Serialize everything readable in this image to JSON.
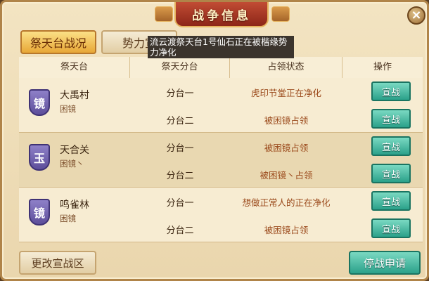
{
  "window": {
    "title": "战争信息",
    "close_label": "×"
  },
  "tabs": [
    {
      "label": "祭天台战况",
      "active": true
    },
    {
      "label": "势力宣",
      "active": false
    }
  ],
  "tooltip": "流云渡祭天台1号仙石正在被楷缘势力净化",
  "table": {
    "headers": [
      "祭天台",
      "祭天分台",
      "占领状态",
      "操作"
    ],
    "groups": [
      {
        "shield_char": "镜",
        "name": "大禹村",
        "occupier": "困镜",
        "rows": [
          {
            "sub": "分台一",
            "status": "虎印节堂正在净化",
            "action": "宣战"
          },
          {
            "sub": "分台二",
            "status": "被困镜占领",
            "action": "宣战"
          }
        ]
      },
      {
        "shield_char": "玉",
        "name": "天合关",
        "occupier": "困镜丶",
        "rows": [
          {
            "sub": "分台一",
            "status": "被困镜占领",
            "action": "宣战"
          },
          {
            "sub": "分台二",
            "status": "被困镜丶占领",
            "action": "宣战"
          }
        ]
      },
      {
        "shield_char": "镜",
        "name": "鸣雀林",
        "occupier": "困镜",
        "rows": [
          {
            "sub": "分台一",
            "status": "想做正常人的正在净化",
            "action": "宣战"
          },
          {
            "sub": "分台二",
            "status": "被困镜占领",
            "action": "宣战"
          }
        ]
      }
    ]
  },
  "footer": {
    "change_zone_label": "更改宣战区",
    "truce_label": "停战申请"
  },
  "colors": {
    "accent_teal": "#2ba18a",
    "status_text": "#9b4a1c",
    "shield_purple": "#5d4e9a"
  }
}
